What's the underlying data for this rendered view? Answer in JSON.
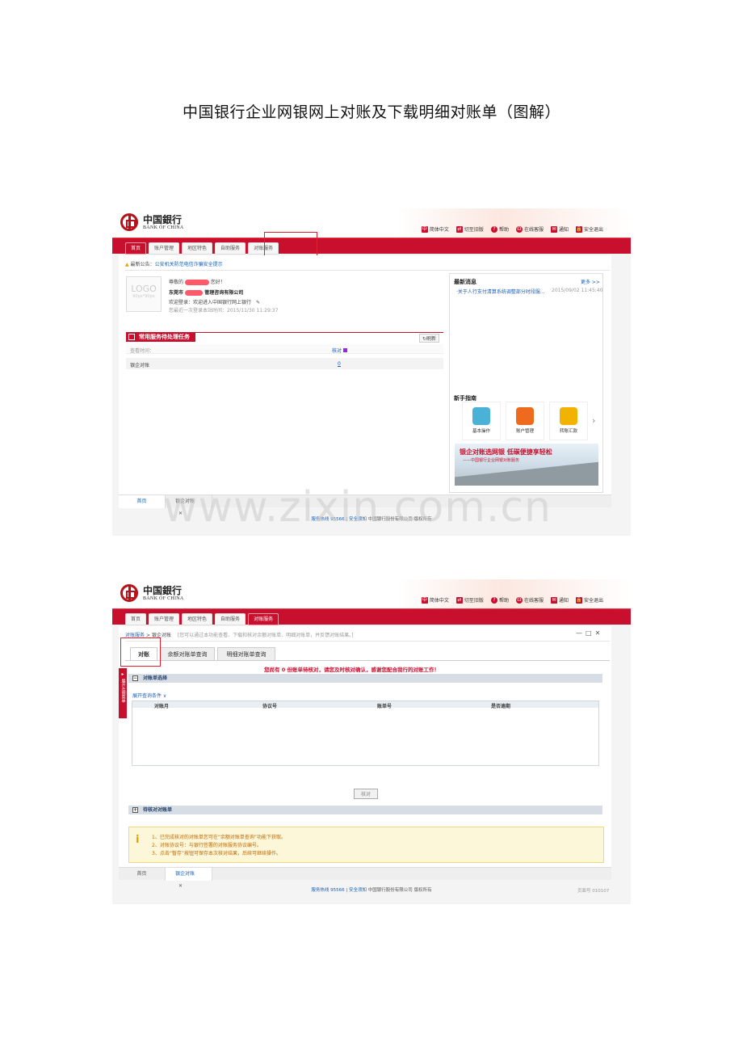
{
  "title": "中国银行企业网银网上对账及下载明细对账单（图解）",
  "brand": {
    "cn": "中国銀行",
    "en": "BANK OF CHINA"
  },
  "colors": {
    "brand_red": "#c8102e",
    "highlight": "#e0212f",
    "link_blue": "#1b5fb5"
  },
  "toolbar": [
    "简体中文",
    "切至旧版",
    "帮助",
    "在线客服",
    "通知",
    "安全退出"
  ],
  "nav_tabs": [
    "首页",
    "账户管理",
    "地区特色",
    "自助服务",
    "对账服务"
  ],
  "shot1": {
    "notice_label": "最新公告：",
    "notice_text": "公安机关防范电信诈骗安全提示",
    "logo_placeholder": "LOGO",
    "logo_size": "90px*90px",
    "greet_prefix": "尊敬的",
    "greet_suffix": "您好！",
    "company_prefix": "东莞市",
    "company_suffix": "管理咨询有限公司",
    "welcome_label": "欢迎登录：",
    "welcome_text": "欢迎进入中国银行网上银行",
    "last_login": "您最近一次登录本站时间：2015/11/30 11:29:37",
    "tasks_title": "常用服务待处理任务",
    "refresh": "刷新",
    "col_time": "查看时间：",
    "col_verify": "核对",
    "row_name": "银企对账",
    "row_count": "0",
    "news_title": "最新消息",
    "news_more": "更多 >>",
    "news_item": "·关于人行支付清算系统调整部分时段服...",
    "news_date": "2015/09/02 11:45:40",
    "guide_title": "新手指南",
    "guides": [
      "基本操作",
      "账户管理",
      "转账汇款"
    ],
    "banner_main": "银企对账选网银 低碳便捷享轻松",
    "banner_sub": "——中国银行企业网银对账服务",
    "bottom_tabs": [
      "首页",
      "银企对账"
    ],
    "footer_hotline_label": "服务热线",
    "footer_hotline": "95566",
    "footer_safety": "安全须知",
    "footer_company": "中国银行股份有限公司",
    "footer_rights": "版权所有",
    "watermark": "www.zixin.com.cn"
  },
  "shot2": {
    "breadcrumb_root": "对账服务",
    "breadcrumb_sep": ">",
    "breadcrumb_leaf": "银企对账",
    "breadcrumb_hint": "[您可以通过本功能查看、下载和核对余额对账单、明细对账单，并反馈对账结果。]",
    "window_controls": [
      "—",
      "□",
      "✕"
    ],
    "side_flag": "展开左侧菜单",
    "tabs": [
      "对账",
      "余额对账单查询",
      "明细对账单查询"
    ],
    "alert": "您尚有 0 份账单待核对，请您及时核对确认，感谢您配合我行的对账工作！",
    "section1": "对账单选择",
    "expand_query": "展开查询条件 ∨",
    "table_cols": [
      "对账月",
      "协议号",
      "账单号",
      "是否逾期"
    ],
    "verify_button": "核对",
    "section2": "待核对对账单",
    "tips": [
      "1、已完成核对的对账单您可在“余额对账单查询”功能下获取。",
      "2、对账协议号：与银行签署的对账服务协议编号。",
      "3、点击“暂存”按钮可保存本次核对结果，后续可继续操作。"
    ],
    "bottom_tabs": [
      "首页",
      "银企对账"
    ],
    "footer_page_no": "页面号 010107"
  }
}
